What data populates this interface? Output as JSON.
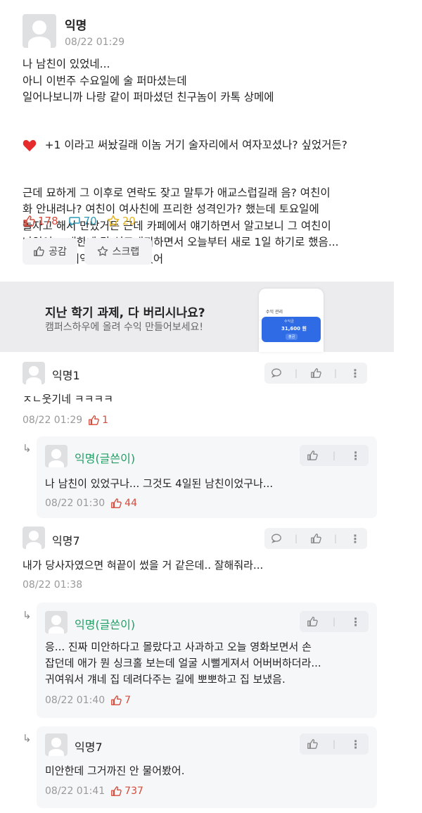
{
  "post": {
    "author": "익명",
    "timestamp": "08/22 01:29",
    "lines": [
      "나 남친이 있었네...",
      "아니 이번주 수요일에 술 퍼마셨는데",
      "일어나보니까 나랑 같이 퍼마셨던 친구놈이 카톡 상메에",
      "+1 이라고 써놨길래 이놈 거기 술자리에서 여자꼬셨나? 싶었거든?",
      "근데 묘하게 그 이후로 연락도 잦고 말투가 애교스럽길래 음? 여친이",
      "화 안내려나? 여친이 여사친에 프리한 성격인가? 했는데 토요일에",
      "놀자고 해서 만났거든 근데 카페에서 얘기하면서 알고보니 그 여친이",
      "나였어... 걔한테 걍 석고대죄하면서 오늘부터 새로 1일 하기로 했음...",
      "술 취해서 기억삭제당한 거였어"
    ],
    "likes": "178",
    "comments": "70",
    "scraps": "20",
    "like_button": "공감",
    "scrap_button": "스크랩"
  },
  "ad": {
    "title": "지난 학기 과제, 다 버리시나요?",
    "subtitle": "캠퍼스하우에 올려 수익 만들어보세요!",
    "phone_header": "수익 관리",
    "phone_amount": "31,600 원",
    "phone_label": "수익금",
    "phone_button": "출금"
  },
  "comments": [
    {
      "author": "익명1",
      "text": "ㅈㄴ웃기네 ㅋㅋㅋㅋ",
      "timestamp": "08/22 01:29",
      "likes": "1"
    },
    {
      "author": "익명(글쓴이)",
      "text": "나 남친이 있었구나... 그것도 4일된 남친이었구나...",
      "timestamp": "08/22 01:30",
      "likes": "44"
    },
    {
      "author": "익명7",
      "text": "내가 당사자였으면 혀끝이 썼을 거 같은데.. 잘해줘라...",
      "timestamp": "08/22 01:38",
      "likes": ""
    },
    {
      "author": "익명(글쓴이)",
      "lines": [
        "응... 진짜 미안하다고 몰랐다고 사과하고 오늘 영화보면서 손",
        "잡던데 애가 뭔 싱크홀 보는데 얼굴 시뻘게져서 어버버하더라...",
        "귀여워서 걔네 집 데려다주는 길에 뽀뽀하고 집 보냈음."
      ],
      "timestamp": "08/22 01:40",
      "likes": "7"
    },
    {
      "author": "익명7",
      "text": "미안한데 그거까진 안 물어봤어.",
      "timestamp": "08/22 01:41",
      "likes": "737"
    }
  ],
  "colors": {
    "like_red": "#d64a3a",
    "comment_blue": "#2f9ab8",
    "scrap_gold": "#e6b422",
    "op_green": "#1e9e63",
    "ad_blue": "#2f6be5"
  }
}
